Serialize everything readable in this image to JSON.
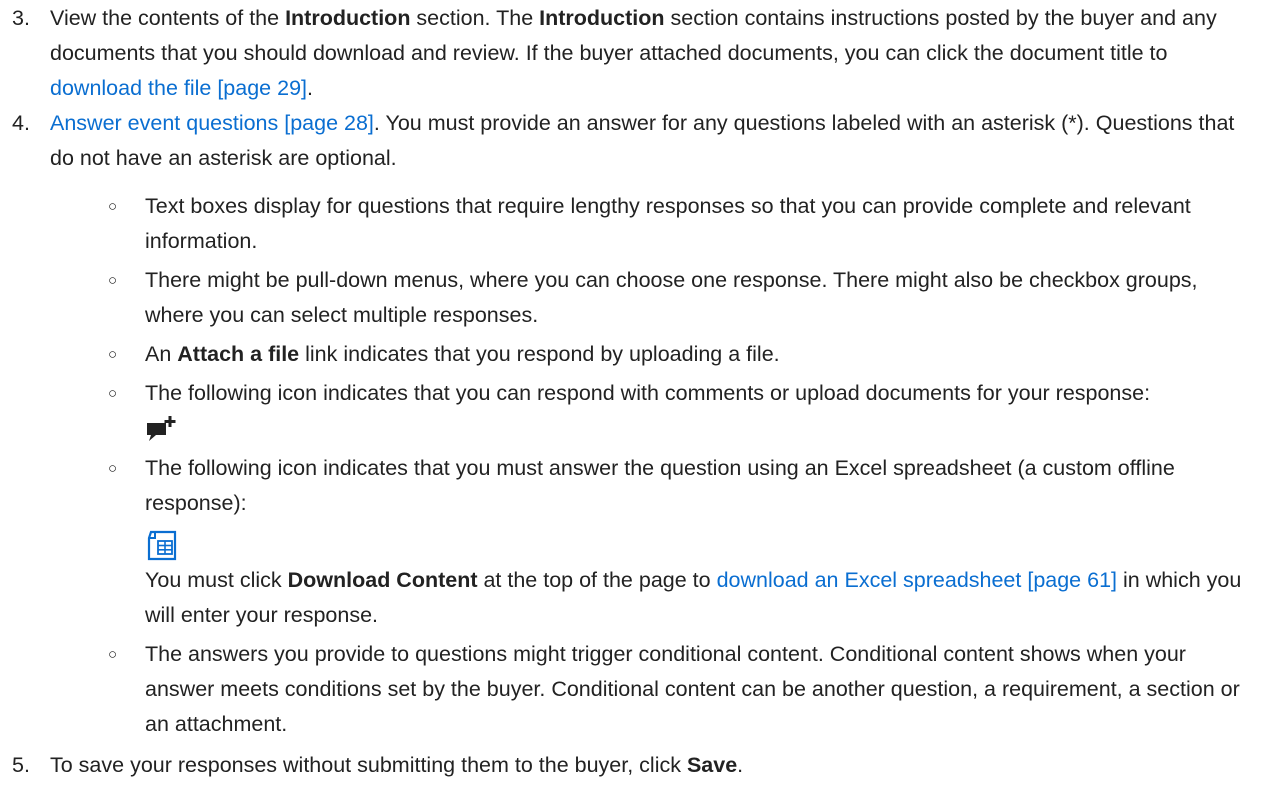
{
  "steps": [
    {
      "number": "3.",
      "t1": "View the contents of the ",
      "b1": "Introduction",
      "t2": " section. The ",
      "b2": "Introduction",
      "t3": " section contains instructions posted by the buyer and any documents that you should download and review. If the buyer attached documents, you can click the document title to ",
      "link": "download the file [page 29]",
      "t4": "."
    },
    {
      "number": "4.",
      "link": "Answer event questions [page 28]",
      "t1": ". You must provide an answer for any questions labeled with an asterisk (*). Questions that do not have an asterisk are optional.",
      "sub_items": [
        {
          "bullet": "○",
          "text": "Text boxes display for questions that require lengthy responses so that you can provide complete and relevant information."
        },
        {
          "bullet": "○",
          "text": "There might be pull-down menus, where you can choose one response. There might also be checkbox groups, where you can select multiple responses."
        },
        {
          "bullet": "○",
          "t1": "An ",
          "b1": "Attach a file",
          "t2": " link indicates that you respond by uploading a file."
        },
        {
          "bullet": "○",
          "text": "The following icon indicates that you can respond with comments or upload documents for your response:",
          "icon": "comment-plus-icon"
        },
        {
          "bullet": "○",
          "text": "The following icon indicates that you must answer the question using an Excel spreadsheet (a custom offline response):",
          "icon": "spreadsheet-icon",
          "t1": "You must click ",
          "b1": "Download Content",
          "t2": " at the top of the page to ",
          "link": "download an Excel spreadsheet [page 61]",
          "t3": " in which you will enter your response."
        },
        {
          "bullet": "○",
          "text": "The answers you provide to questions might trigger conditional content. Conditional content shows when your answer meets conditions set by the buyer. Conditional content can be another question, a requirement, a section or an attachment."
        }
      ]
    },
    {
      "number": "5.",
      "t1": "To save your responses without submitting them to the buyer, click ",
      "b1": "Save",
      "t2": "."
    }
  ],
  "colors": {
    "text": "#222222",
    "link": "#0a6ed1",
    "icon_dark": "#222222",
    "icon_blue": "#0a6ed1"
  }
}
